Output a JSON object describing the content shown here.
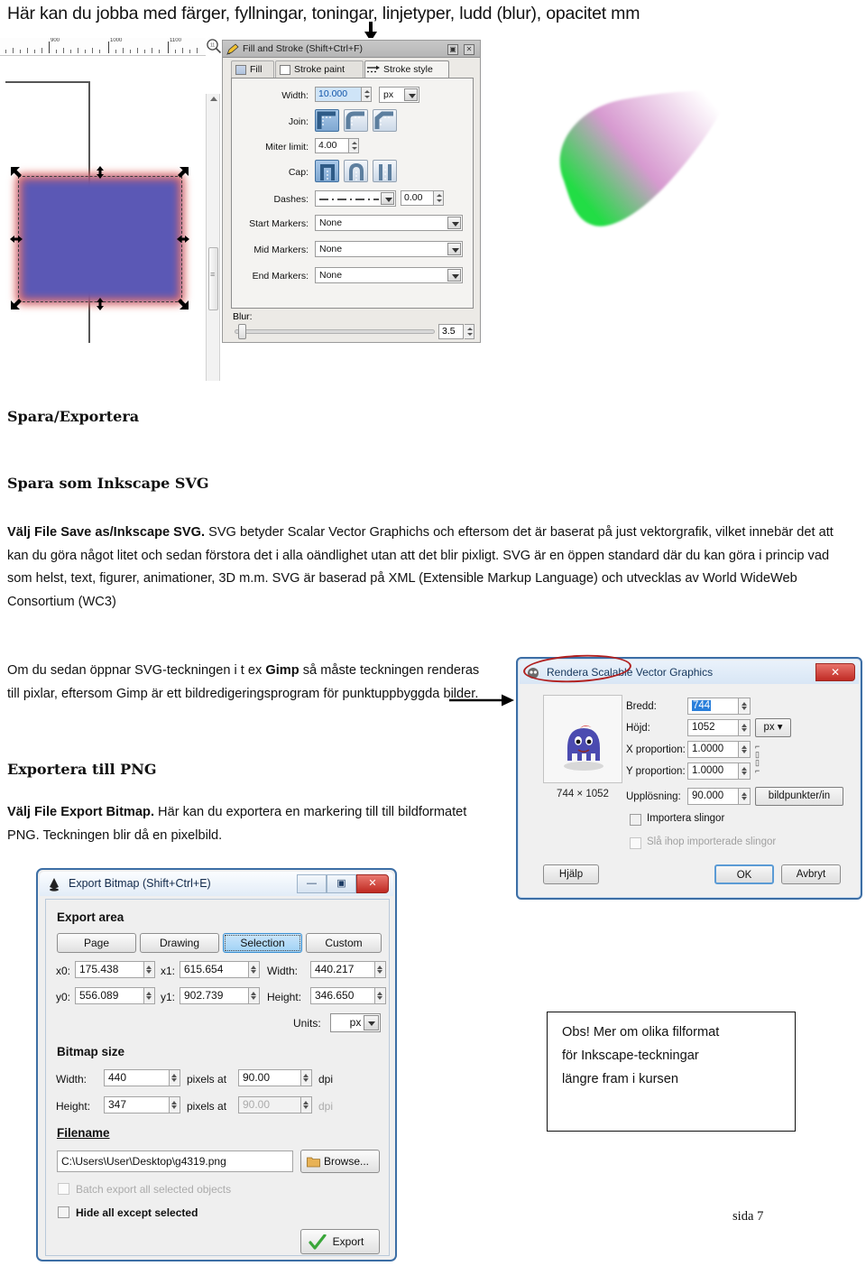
{
  "header": {
    "text": "Här kan du jobba med färger, fyllningar, toningar, linjetyper, ludd (blur), opacitet mm",
    "arrow_icon": "down-arrow-icon"
  },
  "canvas": {
    "ruler_labels": [
      "900",
      "1000",
      "1100"
    ],
    "zoom_icon": "magnifier-icon",
    "selection_handles": "resize-arrow-handles"
  },
  "fill_stroke_dialog": {
    "title": "Fill and Stroke (Shift+Ctrl+F)",
    "dock_button": "▣",
    "close_button": "✕",
    "tabs": [
      {
        "label": "Fill",
        "active": false
      },
      {
        "label": "Stroke paint",
        "active": false
      },
      {
        "label": "Stroke style",
        "active": true
      }
    ],
    "width": {
      "label": "Width:",
      "value": "10.000",
      "unit": "px"
    },
    "join": {
      "label": "Join:",
      "options": [
        "miter-join",
        "round-join",
        "bevel-join"
      ],
      "selected": 0
    },
    "miter_limit": {
      "label": "Miter limit:",
      "value": "4.00"
    },
    "cap": {
      "label": "Cap:",
      "options": [
        "butt-cap",
        "round-cap",
        "square-cap"
      ],
      "selected": 0
    },
    "dashes": {
      "label": "Dashes:",
      "pattern": "— · — · — · —",
      "offset": "0.00"
    },
    "start_markers": {
      "label": "Start Markers:",
      "value": "None"
    },
    "mid_markers": {
      "label": "Mid Markers:",
      "value": "None"
    },
    "end_markers": {
      "label": "End Markers:",
      "value": "None"
    },
    "blur": {
      "label": "Blur:",
      "value": "3.5"
    }
  },
  "body": {
    "heading1": "Spara/Exportera",
    "heading2": "Spara som Inkscape SVG",
    "para1_bold": "Välj File Save as/Inkscape SVG.",
    "para1_rest": " SVG betyder Scalar Vector Graphichs och eftersom det är baserat på just vektorgrafik, vilket innebär det att kan du göra något litet och sedan förstora det i alla oändlighet utan att det blir pixligt. SVG är en öppen standard där du kan göra i princip vad som helst, text, figurer, animationer, 3D m.m. SVG är baserad på XML (Extensible Markup Language) och utvecklas av World WideWeb Consortium (WC3)",
    "para2_pre": "Om du sedan öppnar SVG-teckningen i t ex ",
    "para2_bold": "Gimp",
    "para2_post": " så måste teckningen renderas till pixlar, eftersom Gimp är ett bildredigeringsprogram för punktuppbyggda bilder.",
    "heading3": "Exportera till PNG",
    "para3_bold": "Välj File Export Bitmap.",
    "para3_rest": " Här kan du exportera en markering till till bildformatet PNG. Teckningen blir då en pixelbild."
  },
  "gimp_dialog": {
    "title": "Rendera Scalable Vector Graphics",
    "close_button": "✕",
    "preview_dims": "744 × 1052",
    "width": {
      "label": "Bredd:",
      "value": "744"
    },
    "height": {
      "label": "Höjd:",
      "value": "1052"
    },
    "unit": "px ▾",
    "x_proportion": {
      "label": "X proportion:",
      "value": "1.0000"
    },
    "y_proportion": {
      "label": "Y proportion:",
      "value": "1.0000"
    },
    "resolution": {
      "label": "Upplösning:",
      "value": "90.000",
      "unit": "bildpunkter/in"
    },
    "import_paths": {
      "label": "Importera slingor",
      "checked": false
    },
    "merge_paths": {
      "label": "Slå ihop importerade slingor",
      "checked": false,
      "disabled": true
    },
    "buttons": {
      "help": "Hjälp",
      "ok": "OK",
      "cancel": "Avbryt"
    }
  },
  "export_dialog": {
    "title": "Export Bitmap (Shift+Ctrl+E)",
    "window_buttons": {
      "minimize": "—",
      "maximize": "▣",
      "close": "✕"
    },
    "export_area_heading": "Export area",
    "area_buttons": [
      {
        "label": "Page",
        "active": false
      },
      {
        "label": "Drawing",
        "active": false
      },
      {
        "label": "Selection",
        "active": true
      },
      {
        "label": "Custom",
        "active": false
      }
    ],
    "x0": {
      "label": "x0:",
      "value": "175.438"
    },
    "x1": {
      "label": "x1:",
      "value": "615.654"
    },
    "width": {
      "label": "Width:",
      "value": "440.217"
    },
    "y0": {
      "label": "y0:",
      "value": "556.089"
    },
    "y1": {
      "label": "y1:",
      "value": "902.739"
    },
    "height": {
      "label": "Height:",
      "value": "346.650"
    },
    "units": {
      "label": "Units:",
      "value": "px"
    },
    "bitmap_size_heading": "Bitmap size",
    "bm_width": {
      "label": "Width:",
      "value": "440",
      "mid": "pixels at",
      "dpi_value": "90.00",
      "dpi_label": "dpi"
    },
    "bm_height": {
      "label": "Height:",
      "value": "347",
      "mid": "pixels at",
      "dpi_value": "90.00",
      "dpi_label": "dpi"
    },
    "filename_heading": "Filename",
    "filename_value": "C:\\Users\\User\\Desktop\\g4319.png",
    "browse_button": "Browse...",
    "batch_export": {
      "label": "Batch export all selected objects",
      "checked": false,
      "disabled": true
    },
    "hide_all": {
      "label": "Hide all except selected",
      "checked": false
    },
    "export_button": "Export"
  },
  "note_box": {
    "line1": "Obs! Mer om olika filformat",
    "line2": "för Inkscape-teckningar",
    "line3": "längre fram i kursen"
  },
  "page_number": "sida 7",
  "colors": {
    "rect_fill": "#5b58b5",
    "rect_stroke": "#e05c56",
    "accent_blue": "#3c6ea5",
    "close_red": "#bf2a22",
    "blob_green": "#22dd44",
    "blob_pink": "#d79ad0"
  }
}
